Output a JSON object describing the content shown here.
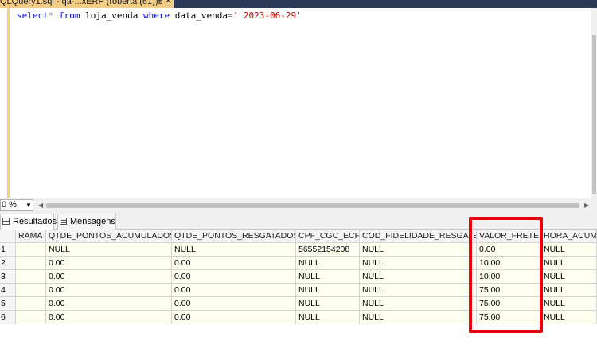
{
  "tab": {
    "title": "QLQuery1.sql - qa-...xERP (roberta (61))*",
    "pin": "⊕",
    "close": "✕"
  },
  "editor": {
    "code": {
      "kw_select": "select",
      "op_star": "*",
      "kw_from": "from",
      "table": "loja_venda",
      "kw_where": "where",
      "column": "data_venda",
      "op_eq": "=",
      "literal": "' 2023-06-29'"
    }
  },
  "zoom": {
    "value": "0 %",
    "arrow": "▼"
  },
  "result_tabs": {
    "results": "Resultados",
    "messages": "Mensagens"
  },
  "grid": {
    "columns": [
      "",
      "RAMA",
      "QTDE_PONTOS_ACUMULADOS",
      "QTDE_PONTOS_RESGATADOS",
      "CPF_CGC_ECF",
      "COD_FIDELIDADE_RESGATE",
      "VALOR_FRETE",
      "HORA_ACUMU"
    ],
    "rows": [
      [
        "1",
        "",
        "NULL",
        "NULL",
        "56552154208",
        "NULL",
        "0.00",
        "NULL"
      ],
      [
        "2",
        "",
        "0.00",
        "0.00",
        "NULL",
        "NULL",
        "10.00",
        "NULL"
      ],
      [
        "3",
        "",
        "0.00",
        "0.00",
        "NULL",
        "NULL",
        "10.00",
        "NULL"
      ],
      [
        "4",
        "",
        "0.00",
        "0.00",
        "NULL",
        "NULL",
        "75.00",
        "NULL"
      ],
      [
        "5",
        "",
        "0.00",
        "0.00",
        "NULL",
        "NULL",
        "75.00",
        "NULL"
      ],
      [
        "6",
        "",
        "0.00",
        "0.00",
        "NULL",
        "NULL",
        "75.00",
        "NULL"
      ]
    ]
  },
  "colors": {
    "highlight": "#e8000d",
    "tab_active": "#f5cc84",
    "keyword": "#0000ff",
    "string": "#d00000"
  }
}
